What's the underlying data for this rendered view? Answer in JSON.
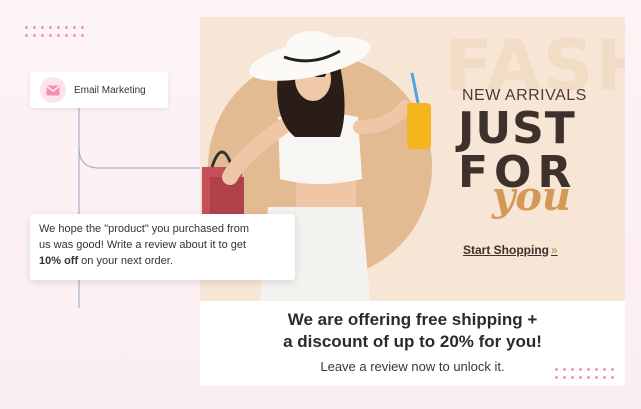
{
  "email_node": {
    "label": "Email Marketing",
    "icon": "mail-icon"
  },
  "review_message": {
    "line1": "We hope the \"product\" you purchased from",
    "line2": "us was good! Write a review about it to get",
    "discount": "10% off",
    "line3_rest": " on your next order."
  },
  "banner": {
    "ghost_text": "FASHION",
    "new_arrivals": "NEW ARRIVALS",
    "just": "JUST",
    "for": "FOR",
    "you": "you",
    "cta": "Start Shopping",
    "cta_arrow": "»"
  },
  "offer": {
    "line1": "We are offering free shipping +",
    "line2": "a discount of up to 20% for you!",
    "line3": "Leave a review now to unlock it."
  },
  "colors": {
    "accent_pink": "#f39bb3",
    "banner_bg": "#f7e6d6",
    "brand_dark": "#3e302b",
    "brand_gold": "#d39a55"
  }
}
